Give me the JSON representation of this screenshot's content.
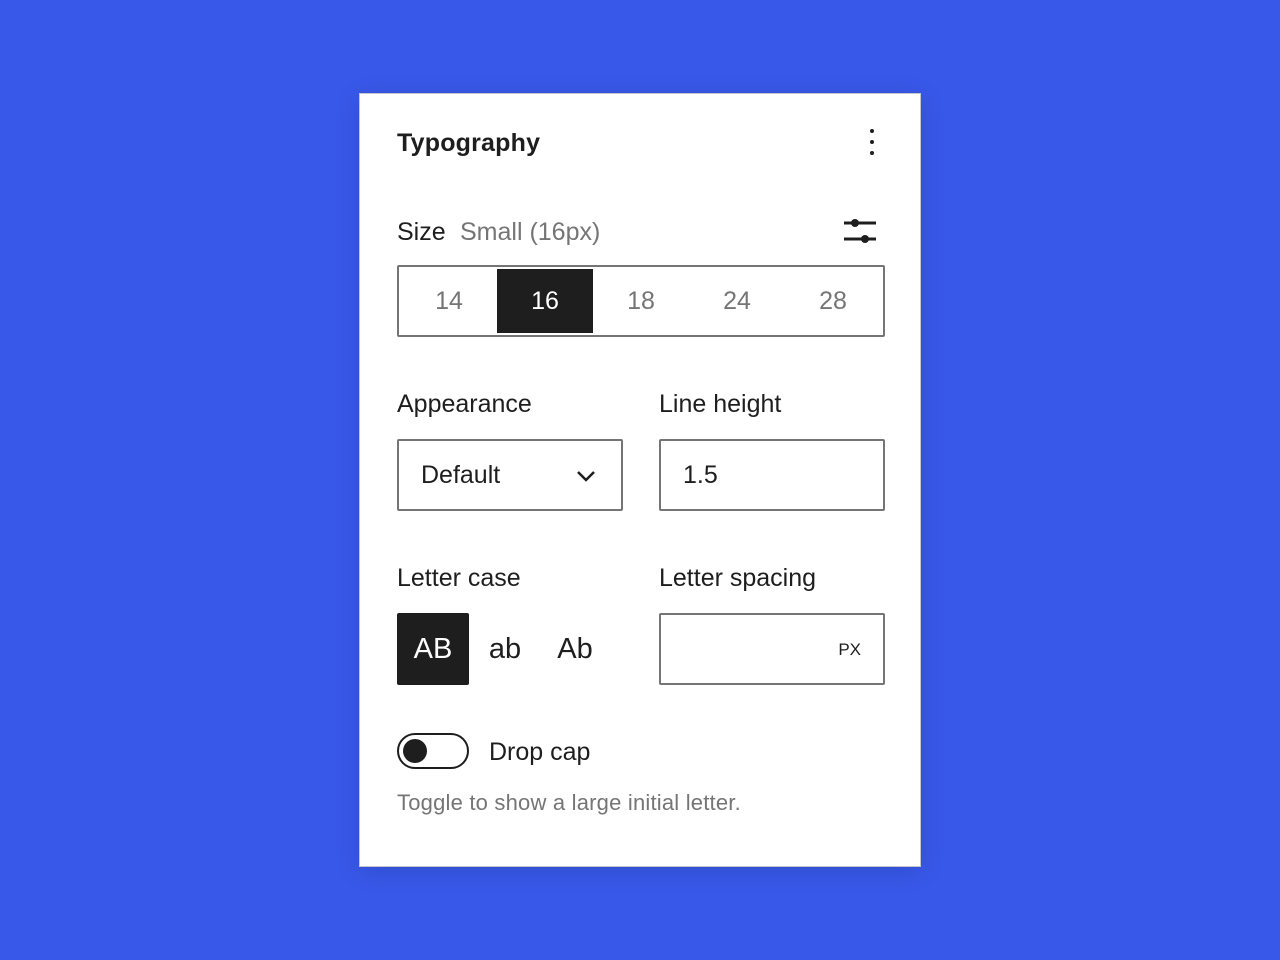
{
  "panel": {
    "title": "Typography",
    "more_icon": "more-vertical-icon"
  },
  "size": {
    "label": "Size",
    "value": "Small (16px)",
    "custom_icon": "settings-sliders-icon",
    "options": [
      "14",
      "16",
      "18",
      "24",
      "28"
    ],
    "selected": "16"
  },
  "appearance": {
    "label": "Appearance",
    "value": "Default",
    "icon": "chevron-down-icon"
  },
  "line_height": {
    "label": "Line height",
    "value": "1.5"
  },
  "letter_case": {
    "label": "Letter case",
    "options": [
      "AB",
      "ab",
      "Ab"
    ],
    "selected": "AB"
  },
  "letter_spacing": {
    "label": "Letter spacing",
    "value": "",
    "unit": "PX"
  },
  "drop_cap": {
    "label": "Drop cap",
    "enabled": false,
    "help": "Toggle to show a large initial letter."
  },
  "colors": {
    "background": "#3858e9",
    "panel": "#ffffff",
    "primary": "#1e1e1e",
    "muted": "#757575"
  }
}
